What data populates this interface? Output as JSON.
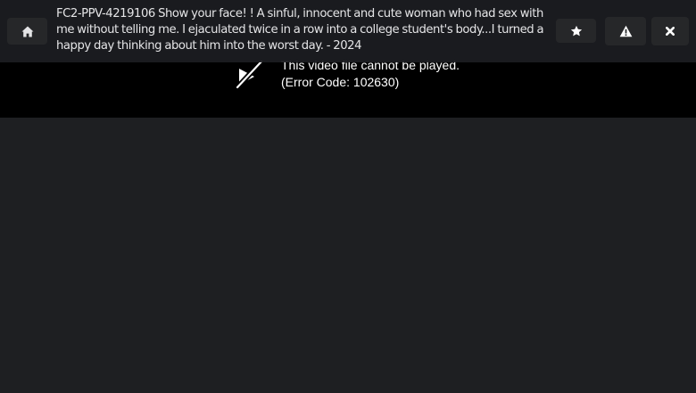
{
  "header": {
    "title": "FC2-PPV-4219106 Show your face! ! A sinful, innocent and cute woman who had sex with me without telling me. I ejaculated twice in a row into a college student's body...I turned a happy day thinking about him into the worst day. - 2024",
    "buttons": {
      "home_icon": "home-icon",
      "favorite_icon": "star-icon",
      "report_icon": "warning-icon",
      "close_icon": "close-icon"
    }
  },
  "player": {
    "error_icon": "video-off-icon",
    "error_message": "This video file cannot be played.",
    "error_code": "(Error Code: 102630)"
  },
  "colors": {
    "page_background": "#1e1f22",
    "header_background": "#1c1d21",
    "button_background": "#262729",
    "player_background": "#000000",
    "text": "#e4e4e6"
  }
}
